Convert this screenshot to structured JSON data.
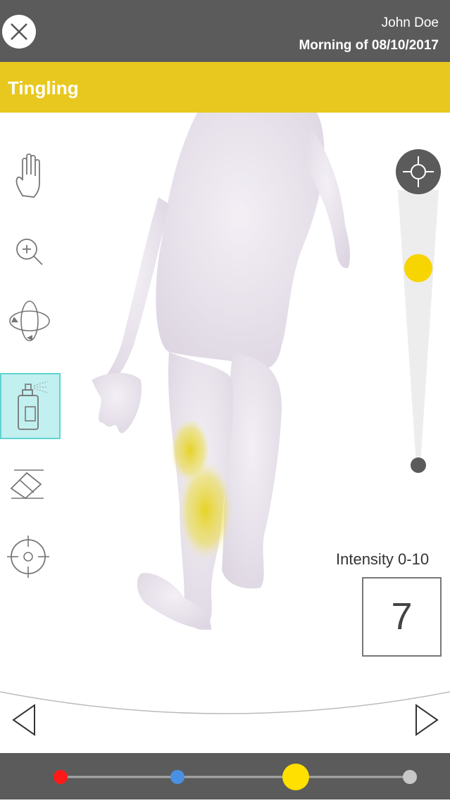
{
  "header": {
    "user_name": "John Doe",
    "session": "Morning of 08/10/2017"
  },
  "symptom": {
    "title": "Tingling",
    "color": "#e8c81e"
  },
  "tools": [
    {
      "name": "hand-icon",
      "active": false
    },
    {
      "name": "zoom-in-icon",
      "active": false
    },
    {
      "name": "rotate-icon",
      "active": false
    },
    {
      "name": "spray-can-icon",
      "active": true
    },
    {
      "name": "eraser-icon",
      "active": false
    },
    {
      "name": "crosshair-icon",
      "active": false
    }
  ],
  "intensity": {
    "label": "Intensity 0-10",
    "value": "7",
    "slider_fraction": 0.7
  },
  "timeline": {
    "points": [
      {
        "color": "#ff1a1a"
      },
      {
        "color": "#4a90e2"
      },
      {
        "color": "#ffe000"
      },
      {
        "color": "#c8c8c8"
      }
    ]
  }
}
